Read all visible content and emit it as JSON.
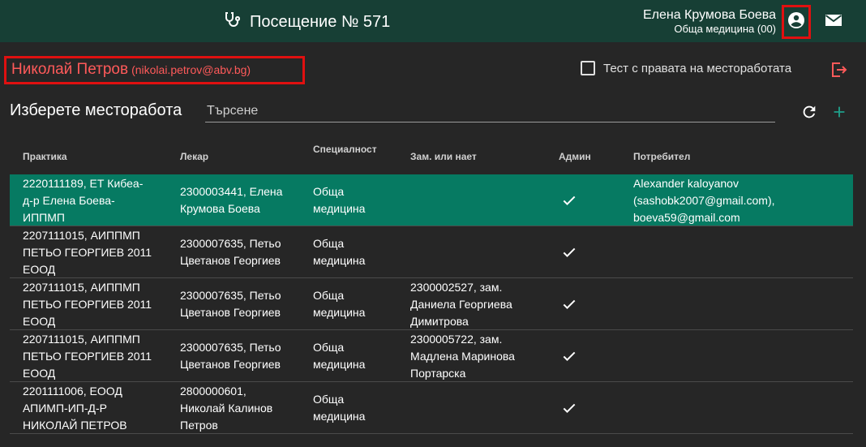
{
  "header": {
    "visit_title": "Посещение № 571",
    "user_name": "Елена Крумова Боева",
    "user_role": "Обща медицина (00)",
    "stethoscope_icon": "stethoscope-icon",
    "account_icon": "account-circle-icon",
    "mail_icon": "mail-icon"
  },
  "patient": {
    "name": "Николай Петров",
    "email": "(nikolai.petrov@abv.bg)"
  },
  "test_rights_label": "Тест с правата на месторабoтата",
  "section_title": "Изберете месторабота",
  "search": {
    "placeholder": "Търсене",
    "value": ""
  },
  "table": {
    "columns": [
      "Практика",
      "Лекар",
      "Специалност",
      "Зам. или нает",
      "Админ",
      "Потребител"
    ],
    "rows": [
      {
        "practice": [
          "2220111189, ЕТ Кибеа-",
          "д-р Елена Боева-",
          "ИППМП"
        ],
        "doctor": [
          "2300003441, Елена",
          "Крумова Боева"
        ],
        "specialty": [
          "Обща",
          "медицина"
        ],
        "substitute": [],
        "admin": true,
        "user": [
          "Alexander kaloyanov",
          "(sashobk2007@gmail.com),",
          "boeva59@gmail.com"
        ],
        "selected": true
      },
      {
        "practice": [
          "2207111015, АИППМП",
          "ПЕТЬО ГЕОРГИЕВ 2011",
          "ЕООД"
        ],
        "doctor": [
          "2300007635, Петьо",
          "Цветанов Георгиев"
        ],
        "specialty": [
          "Обща",
          "медицина"
        ],
        "substitute": [],
        "admin": true,
        "user": [],
        "selected": false
      },
      {
        "practice": [
          "2207111015, АИППМП",
          "ПЕТЬО ГЕОРГИЕВ 2011",
          "ЕООД"
        ],
        "doctor": [
          "2300007635, Петьо",
          "Цветанов Георгиев"
        ],
        "specialty": [
          "Обща",
          "медицина"
        ],
        "substitute": [
          "2300002527, зам.",
          "Даниела Георгиева",
          "Димитрова"
        ],
        "admin": true,
        "user": [],
        "selected": false
      },
      {
        "practice": [
          "2207111015, АИППМП",
          "ПЕТЬО ГЕОРГИЕВ 2011",
          "ЕООД"
        ],
        "doctor": [
          "2300007635, Петьо",
          "Цветанов Георгиев"
        ],
        "specialty": [
          "Обща",
          "медицина"
        ],
        "substitute": [
          "2300005722, зам.",
          "Мадлена Маринова",
          "Портарска"
        ],
        "admin": true,
        "user": [],
        "selected": false
      },
      {
        "practice": [
          "2201111006, ЕООД",
          "АПИМП-ИП-Д-Р",
          "НИКОЛАЙ ПЕТРОВ"
        ],
        "doctor": [
          "2800000601,",
          "Николай Калинов",
          "Петров"
        ],
        "specialty": [
          "Обща",
          "медицина"
        ],
        "substitute": [],
        "admin": true,
        "user": [],
        "selected": false
      }
    ]
  },
  "colors": {
    "topbar": "#173f35",
    "background": "#262626",
    "selected_row": "#067a62",
    "highlight_red": "#e01010",
    "patient_text": "#ff5a5a",
    "accent_teal": "#1fa08a"
  }
}
